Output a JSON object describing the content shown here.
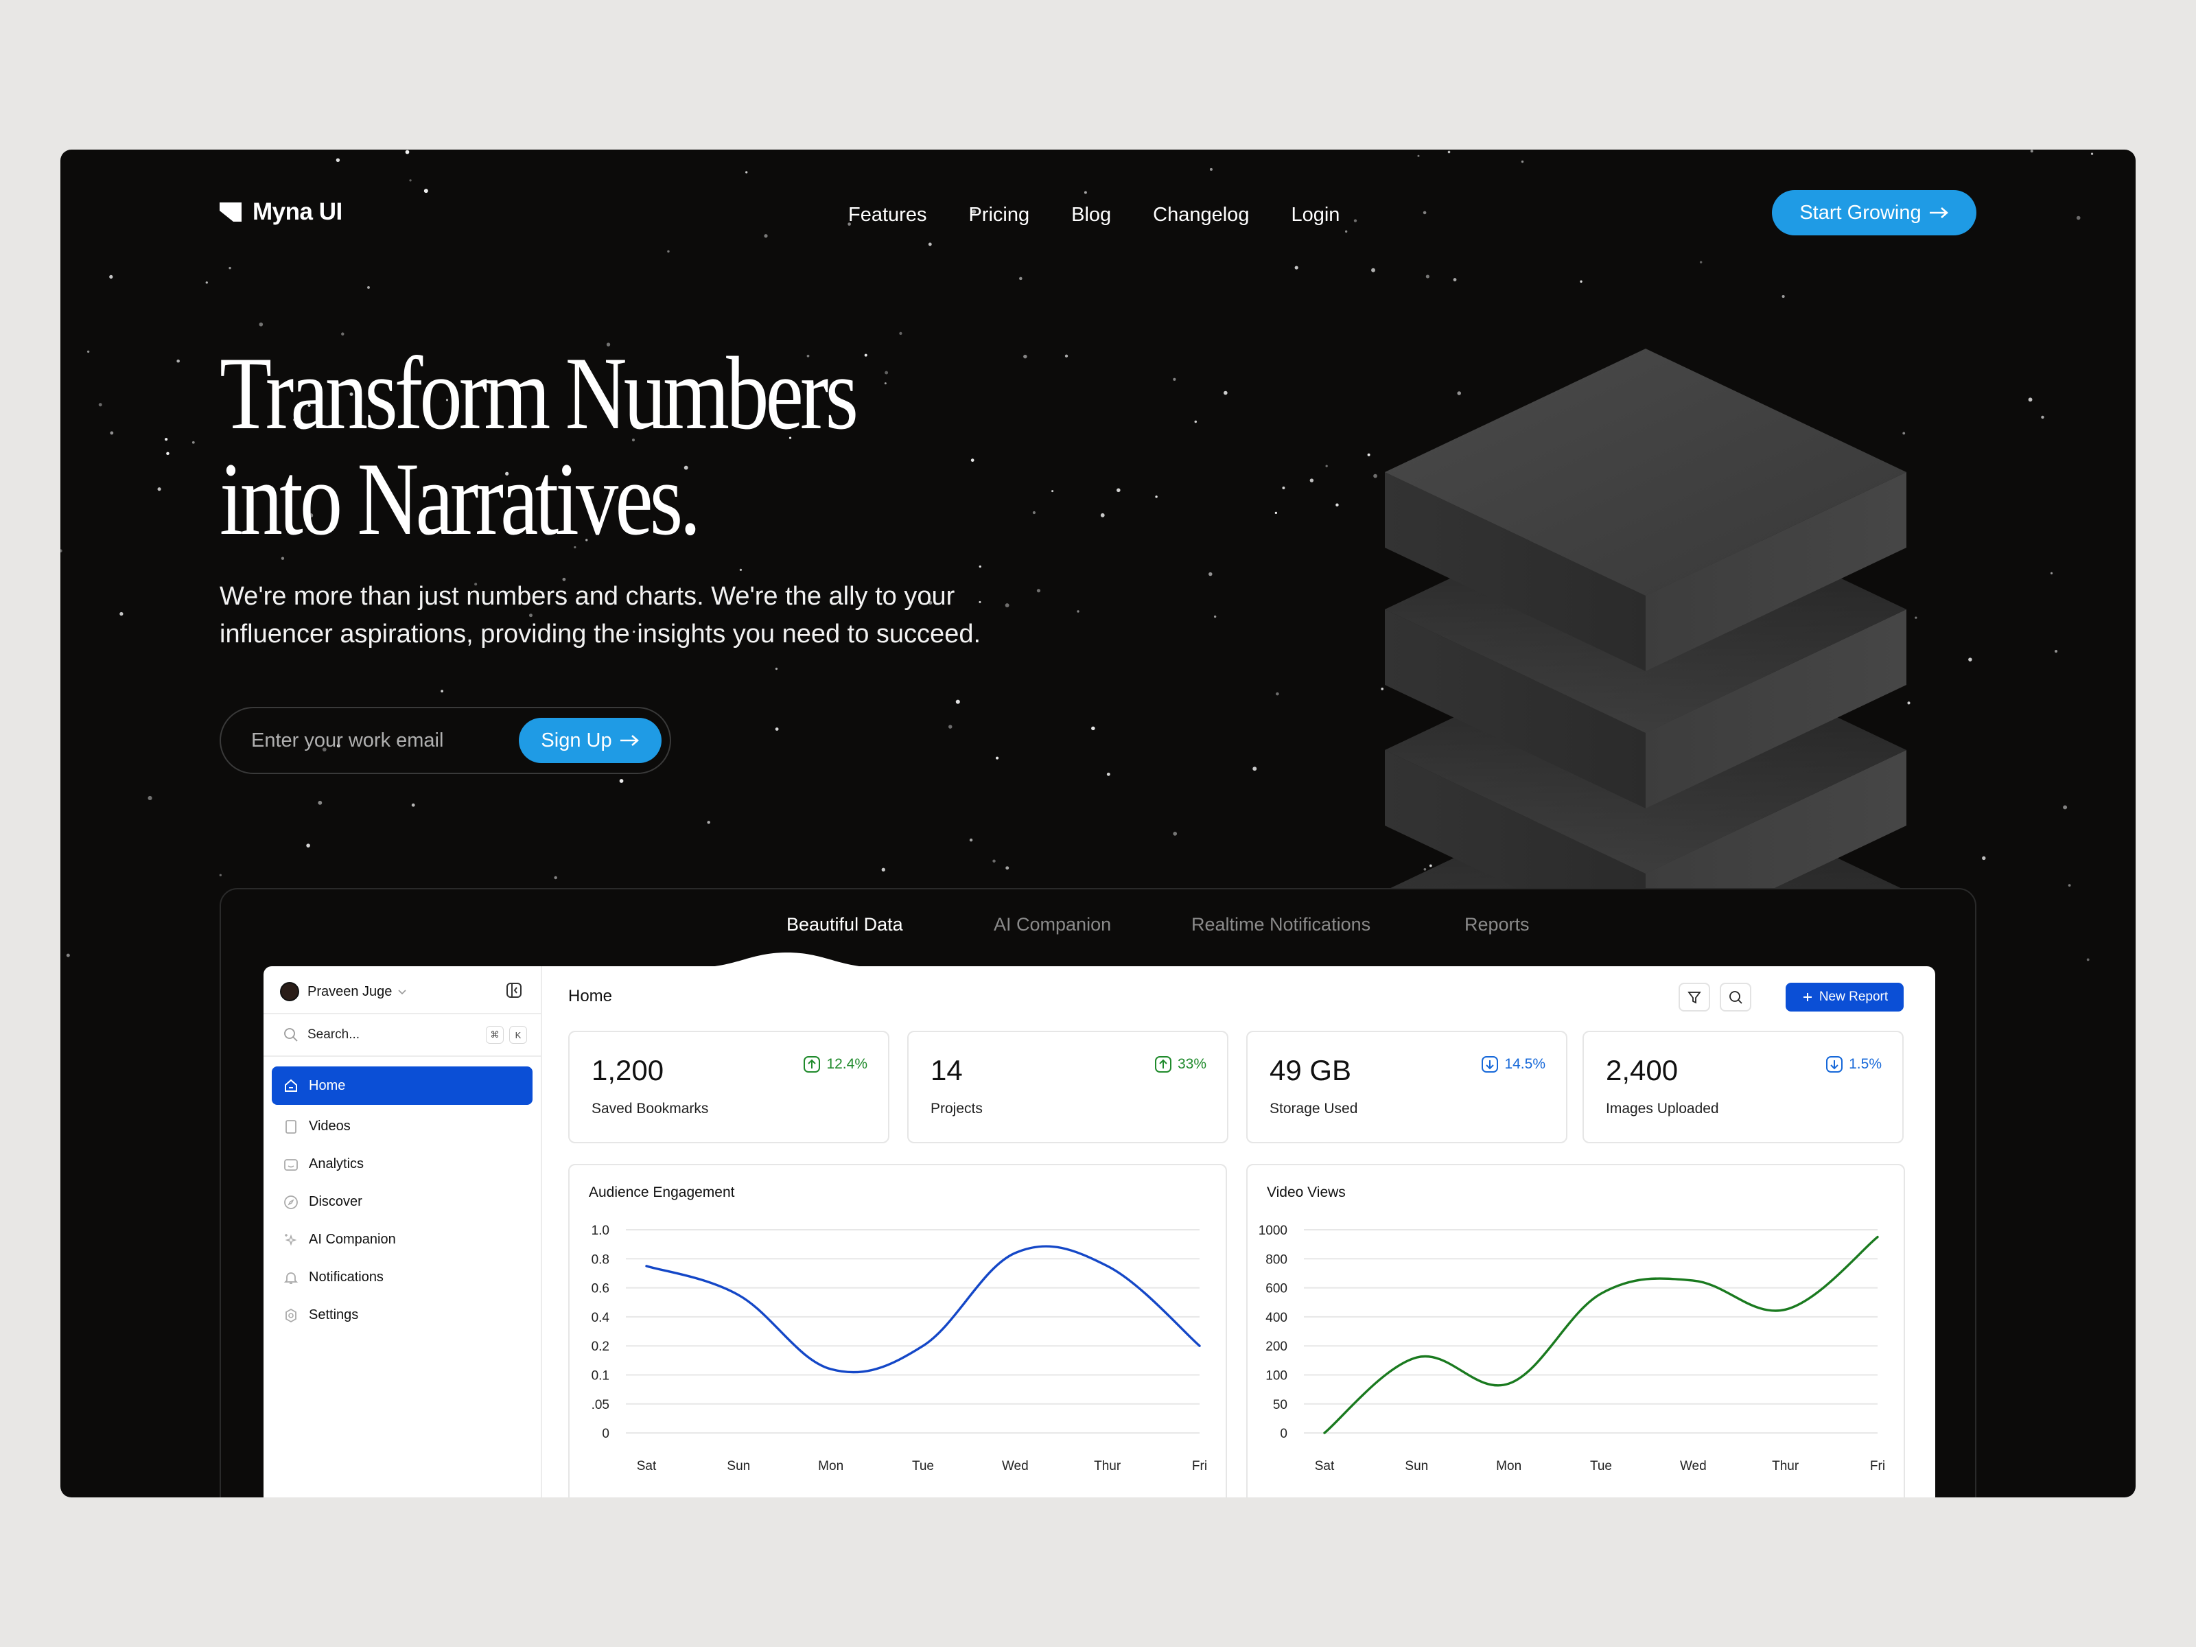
{
  "brand": {
    "name": "Myna UI"
  },
  "nav": {
    "links": [
      "Features",
      "Pricing",
      "Blog",
      "Changelog",
      "Login"
    ],
    "cta": "Start Growing"
  },
  "hero": {
    "headline_line1": "Transform Numbers",
    "headline_line2": "into Narratives.",
    "sub_line1": "We're more than just numbers and charts. We're the ally to your",
    "sub_line2": "influencer aspirations, providing the insights you need to succeed.",
    "email_placeholder": "Enter your work email",
    "signup": "Sign Up"
  },
  "showcase_tabs": [
    {
      "label": "Beautiful Data",
      "active": true
    },
    {
      "label": "AI Companion",
      "active": false
    },
    {
      "label": "Realtime Notifications",
      "active": false
    },
    {
      "label": "Reports",
      "active": false
    }
  ],
  "app": {
    "user": "Praveen Juge",
    "search_placeholder": "Search...",
    "shortcut_keys": [
      "⌘",
      "K"
    ],
    "menu": [
      {
        "label": "Home",
        "icon": "home-icon",
        "active": true
      },
      {
        "label": "Videos",
        "icon": "video-icon",
        "active": false
      },
      {
        "label": "Analytics",
        "icon": "analytics-icon",
        "active": false
      },
      {
        "label": "Discover",
        "icon": "compass-icon",
        "active": false
      },
      {
        "label": "AI Companion",
        "icon": "sparkle-icon",
        "active": false
      },
      {
        "label": "Notifications",
        "icon": "bell-icon",
        "active": false
      },
      {
        "label": "Settings",
        "icon": "gear-icon",
        "active": false
      }
    ],
    "page_title": "Home",
    "new_report": "New Report",
    "stats": [
      {
        "value": "1,200",
        "label": "Saved Bookmarks",
        "delta": "12.4%",
        "direction": "up"
      },
      {
        "value": "14",
        "label": "Projects",
        "delta": "33%",
        "direction": "up"
      },
      {
        "value": "49 GB",
        "label": "Storage Used",
        "delta": "14.5%",
        "direction": "down"
      },
      {
        "value": "2,400",
        "label": "Images Uploaded",
        "delta": "1.5%",
        "direction": "down"
      }
    ]
  },
  "colors": {
    "accent": "#1f9be5",
    "app_primary": "#0b4fd6",
    "positive": "#1f8a2b",
    "engagement_line": "#1447c7",
    "views_line": "#1a7a1f"
  },
  "chart_data": [
    {
      "type": "line",
      "title": "Audience Engagement",
      "categories": [
        "Sat",
        "Sun",
        "Mon",
        "Tue",
        "Wed",
        "Thur",
        "Fri"
      ],
      "y_tick_labels": [
        "1.0",
        "0.8",
        "0.6",
        "0.4",
        "0.2",
        "0.1",
        ".05",
        "0"
      ],
      "series": [
        {
          "values": [
            0.75,
            0.55,
            0.12,
            0.2,
            0.84,
            0.75,
            0.2
          ]
        }
      ],
      "grid": true
    },
    {
      "type": "line",
      "title": "Video Views",
      "categories": [
        "Sat",
        "Sun",
        "Mon",
        "Tue",
        "Wed",
        "Thur",
        "Fri"
      ],
      "y_tick_labels": [
        "1000",
        "800",
        "600",
        "400",
        "200",
        "100",
        "50",
        "0"
      ],
      "series": [
        {
          "values": [
            0,
            160,
            85,
            560,
            650,
            450,
            950
          ]
        }
      ],
      "grid": true
    }
  ]
}
